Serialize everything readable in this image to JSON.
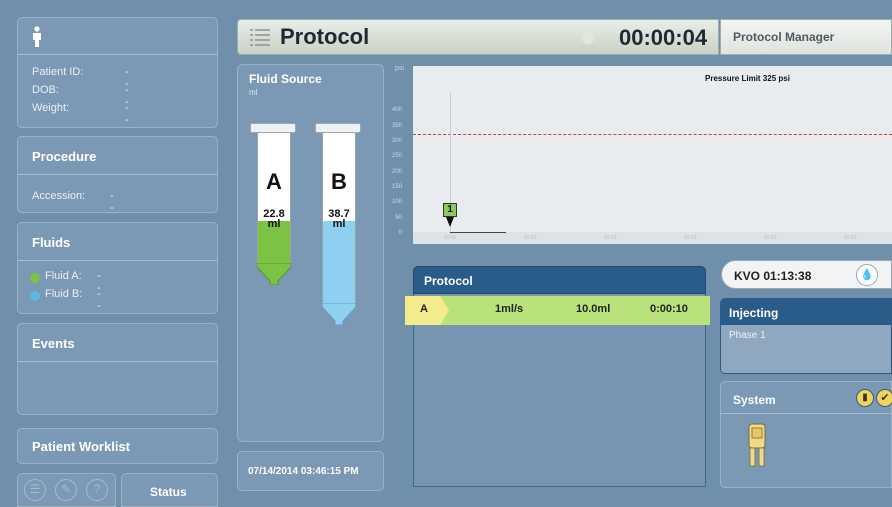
{
  "header": {
    "title": "Protocol",
    "timer": "00:00:04",
    "protocol_manager_label": "Protocol Manager"
  },
  "patient": {
    "fields": [
      {
        "label": "Patient ID:",
        "value": "--"
      },
      {
        "label": "DOB:",
        "value": "--"
      },
      {
        "label": "Weight:",
        "value": "--"
      }
    ]
  },
  "procedure": {
    "title": "Procedure",
    "accession_label": "Accession:",
    "accession_value": "--"
  },
  "fluids": {
    "title": "Fluids",
    "items": [
      {
        "label": "Fluid A:",
        "value": "--",
        "color": "#7cc243"
      },
      {
        "label": "Fluid B:",
        "value": "--",
        "color": "#5fb7e6"
      }
    ]
  },
  "events": {
    "title": "Events"
  },
  "patient_worklist": {
    "label": "Patient Worklist"
  },
  "status": {
    "label": "Status"
  },
  "fluid_source": {
    "title": "Fluid Source",
    "unit": "ml",
    "syringes": [
      {
        "letter": "A",
        "volume": "22.8",
        "unit": "ml",
        "fluid_color": "#7cc243",
        "fill_fraction": 0.32
      },
      {
        "letter": "B",
        "volume": "38.7",
        "unit": "ml",
        "fluid_color": "#8fd0f0",
        "fill_fraction": 0.48
      }
    ],
    "datetime": "07/14/2014 03:46:15 PM"
  },
  "chart_data": {
    "type": "line",
    "title": "",
    "ylabel": "psi",
    "ylim": [
      0,
      450
    ],
    "yticks": [
      "400",
      "350",
      "300",
      "250",
      "200",
      "150",
      "100",
      "50",
      "0"
    ],
    "xticks": [
      "00:00",
      "00:05",
      "00:10",
      "00:15",
      "00:20",
      "00:25"
    ],
    "pressure_limit_label": "Pressure Limit 325 psi",
    "pressure_limit": 325,
    "phase_marker": "1",
    "series": [
      {
        "x": [
          0,
          0.5,
          4
        ],
        "y": [
          0,
          0,
          0
        ]
      }
    ],
    "limit_color": "#d63b3b",
    "grid": false
  },
  "protocol_table": {
    "title": "Protocol",
    "rows": [
      {
        "phase": "A",
        "rate": "1ml/s",
        "volume": "10.0ml",
        "duration": "0:00:10"
      }
    ]
  },
  "kvo": {
    "label": "KVO 01:13:38"
  },
  "injecting": {
    "title": "Injecting",
    "phase": "Phase 1"
  },
  "system": {
    "title": "System"
  }
}
